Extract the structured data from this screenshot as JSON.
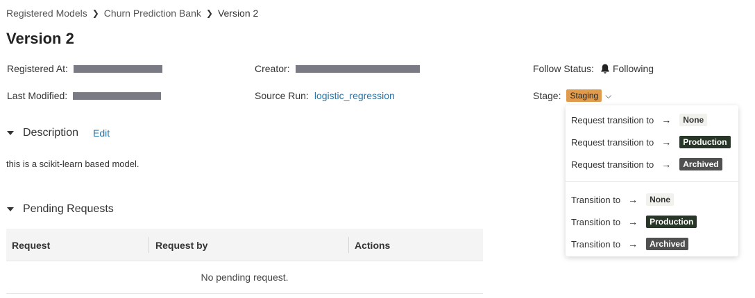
{
  "breadcrumb": {
    "items": [
      "Registered Models",
      "Churn Prediction Bank",
      "Version 2"
    ]
  },
  "page_title": "Version 2",
  "meta": {
    "registered_at_label": "Registered At:",
    "creator_label": "Creator:",
    "follow_status_label": "Follow Status:",
    "follow_status_value": "Following",
    "last_modified_label": "Last Modified:",
    "source_run_label": "Source Run:",
    "source_run_value": "logistic_regression",
    "stage_label": "Stage:",
    "stage_value": "Staging"
  },
  "description": {
    "heading": "Description",
    "edit_label": "Edit",
    "text": "this is a scikit-learn based model."
  },
  "pending": {
    "heading": "Pending Requests",
    "columns": [
      "Request",
      "Request by",
      "Actions"
    ],
    "empty_message": "No pending request."
  },
  "stage_menu": {
    "request_items": [
      {
        "label": "Request transition to",
        "stage": "None"
      },
      {
        "label": "Request transition to",
        "stage": "Production"
      },
      {
        "label": "Request transition to",
        "stage": "Archived"
      }
    ],
    "transition_items": [
      {
        "label": "Transition to",
        "stage": "None"
      },
      {
        "label": "Transition to",
        "stage": "Production"
      },
      {
        "label": "Transition to",
        "stage": "Archived"
      }
    ],
    "arrow": "→"
  },
  "colors": {
    "link": "#2874a6",
    "staging": "#e09c4c",
    "production": "#273626",
    "archived": "#505050",
    "redaction": "#7a7a84"
  }
}
